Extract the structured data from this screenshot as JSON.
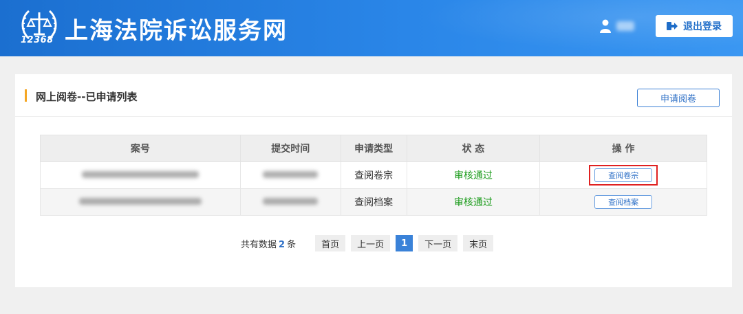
{
  "header": {
    "logo_number": "12368",
    "site_title": "上海法院诉讼服务网",
    "logout_label": "退出登录"
  },
  "panel": {
    "title": "网上阅卷--已申请列表",
    "apply_label": "申请阅卷"
  },
  "table": {
    "columns": [
      "案号",
      "提交时间",
      "申请类型",
      "状 态",
      "操 作"
    ],
    "rows": [
      {
        "type": "查阅卷宗",
        "status": "审核通过",
        "action": "查阅卷宗",
        "highlighted": true
      },
      {
        "type": "查阅档案",
        "status": "审核通过",
        "action": "查阅档案",
        "highlighted": false
      }
    ]
  },
  "pagination": {
    "total_prefix": "共有数据",
    "total_count": "2",
    "total_suffix": "条",
    "first": "首页",
    "prev": "上一页",
    "current": "1",
    "next": "下一页",
    "last": "末页"
  },
  "colors": {
    "header_blue": "#1b6fd0",
    "accent_bar": "#f5a623",
    "status_green": "#1a9b1a",
    "highlight_red": "#e02020",
    "current_page": "#3a82d8"
  }
}
